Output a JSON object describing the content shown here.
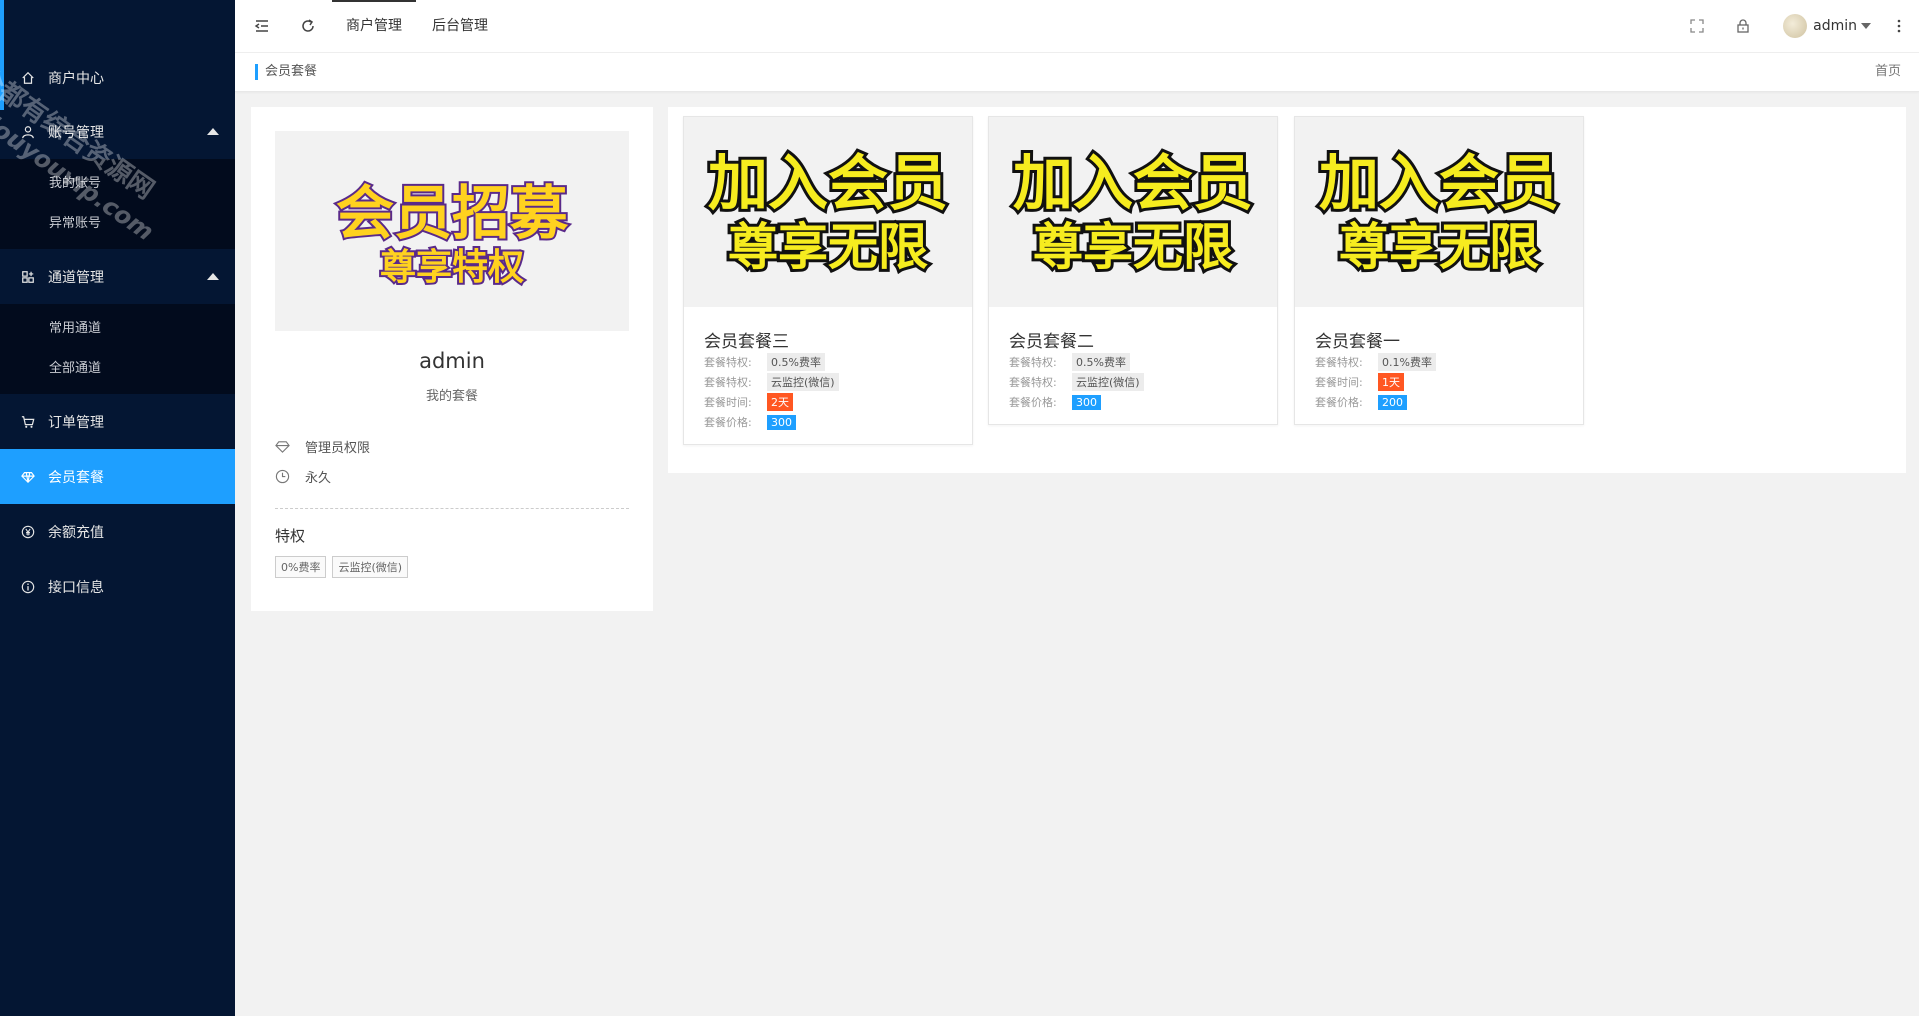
{
  "sidebar": {
    "watermark": [
      "全都有综合资源网",
      "douyouvip.com"
    ],
    "items": [
      {
        "label": "商户中心",
        "icon": "home-icon"
      },
      {
        "label": "账号管理",
        "icon": "user-icon",
        "expanded": true,
        "children": [
          "我的账号",
          "异常账号"
        ]
      },
      {
        "label": "通道管理",
        "icon": "apps-icon",
        "expanded": true,
        "children": [
          "常用通道",
          "全部通道"
        ]
      },
      {
        "label": "订单管理",
        "icon": "cart-icon"
      },
      {
        "label": "会员套餐",
        "icon": "diamond-icon",
        "active": true
      },
      {
        "label": "余额充值",
        "icon": "yen-icon"
      },
      {
        "label": "接口信息",
        "icon": "info-icon"
      }
    ]
  },
  "header": {
    "tabs": [
      "商户管理",
      "后台管理"
    ],
    "active_tab": "商户管理",
    "user": "admin",
    "icons": [
      "menu-fold-icon",
      "refresh-icon",
      "fullscreen-icon",
      "lock-icon",
      "more-icon"
    ]
  },
  "breadcrumb": {
    "current": "会员套餐",
    "home": "首页"
  },
  "profile": {
    "banner_text": [
      "会员招募",
      "尊享特权"
    ],
    "name": "admin",
    "subtitle": "我的套餐",
    "permission": "管理员权限",
    "duration": "永久",
    "privileges_title": "特权",
    "privileges": [
      "0%费率",
      "云监控(微信)"
    ]
  },
  "packages": {
    "banner_text": [
      "加入会员",
      "尊享无限"
    ],
    "items": [
      {
        "title": "会员套餐三",
        "rows": [
          {
            "label": "套餐特权:",
            "value": "0.5%费率",
            "style": "gray"
          },
          {
            "label": "套餐特权:",
            "value": "云监控(微信)",
            "style": "gray"
          },
          {
            "label": "套餐时间:",
            "value": "2天",
            "style": "orange"
          },
          {
            "label": "套餐价格:",
            "value": "300",
            "style": "blue"
          }
        ]
      },
      {
        "title": "会员套餐二",
        "rows": [
          {
            "label": "套餐特权:",
            "value": "0.5%费率",
            "style": "gray"
          },
          {
            "label": "套餐特权:",
            "value": "云监控(微信)",
            "style": "gray"
          },
          {
            "label": "套餐价格:",
            "value": "300",
            "style": "blue"
          }
        ]
      },
      {
        "title": "会员套餐一",
        "rows": [
          {
            "label": "套餐特权:",
            "value": "0.1%费率",
            "style": "gray"
          },
          {
            "label": "套餐时间:",
            "value": "1天",
            "style": "orange"
          },
          {
            "label": "套餐价格:",
            "value": "200",
            "style": "blue"
          }
        ]
      }
    ]
  },
  "colors": {
    "sidebar_bg": "#041633",
    "accent": "#1e9fff",
    "orange": "#ff5722"
  }
}
